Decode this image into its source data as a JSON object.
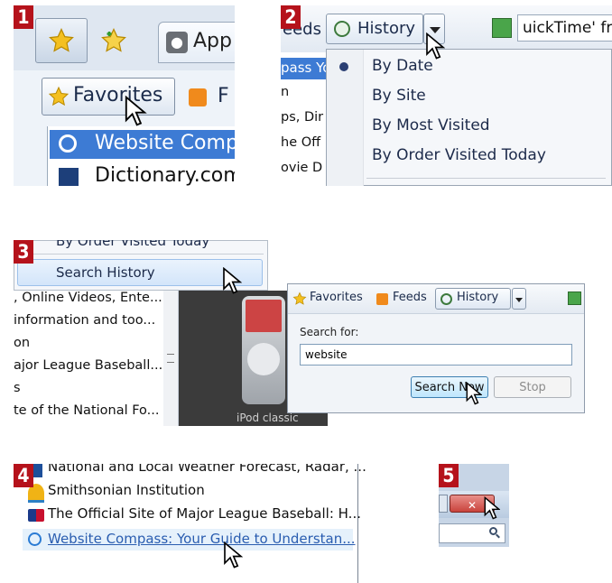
{
  "panel1": {
    "step": "1",
    "app_tab_label": "App",
    "favorites_label": "Favorites",
    "feeds_partial": "F",
    "list": [
      "Website Comp",
      "Dictionary.com"
    ]
  },
  "panel2": {
    "step": "2",
    "feeds_partial": "eeds",
    "history_label": "History",
    "quicktime_partial": "uickTime' fr",
    "side_list": [
      "pass Yo",
      "n",
      "ps, Dir",
      "he Off",
      "ovie D"
    ],
    "menu_items": [
      "By Date",
      "By Site",
      "By Most Visited",
      "By Order Visited Today"
    ],
    "selected_index": 0
  },
  "panel3": {
    "step": "3",
    "menu_top_partial": "By Order Visited Today",
    "search_history": "Search History",
    "list": [
      ", Online Videos, Ente...",
      "information and too...",
      "on",
      "ajor League Baseball...",
      "s",
      "te of the National Fo..."
    ],
    "ipod_caption": "iPod classic",
    "dialog": {
      "favorites": "Favorites",
      "feeds": "Feeds",
      "history": "History",
      "search_for_label": "Search for:",
      "search_value": "website",
      "search_now": "Search Now",
      "stop": "Stop"
    }
  },
  "panel4": {
    "step": "4",
    "results": [
      "National and Local Weather Forecast, Radar, ...",
      "Smithsonian Institution",
      "The Official Site of Major League Baseball: H...",
      "Website Compass: Your Guide to Understan..."
    ]
  },
  "panel5": {
    "step": "5",
    "close_glyph": "✕"
  },
  "colors": {
    "step_badge": "#b5121b",
    "selection_blue": "#3d7bd4",
    "link_blue": "#2a5db0",
    "close_red": "#d9534f"
  }
}
